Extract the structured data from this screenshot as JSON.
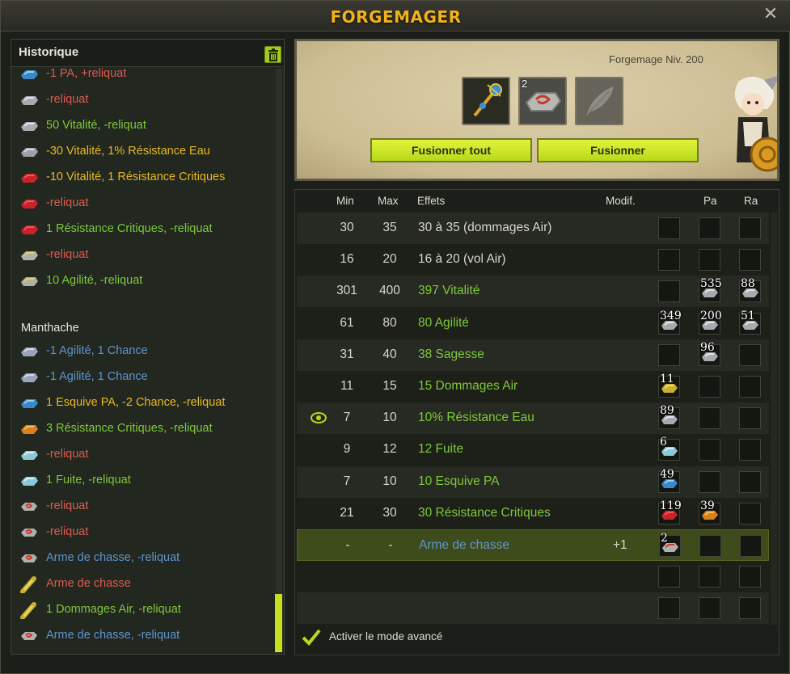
{
  "window": {
    "title": "FORGEMAGER",
    "close_label": "✕"
  },
  "history": {
    "title": "Historique",
    "entries_top": [
      {
        "text": "-1 PA, +reliquat",
        "color": "red",
        "icon": "blue-rune-icon"
      },
      {
        "text": "-reliquat",
        "color": "red",
        "icon": "gray-rune-icon"
      },
      {
        "text": "50 Vitalité, -reliquat",
        "color": "green",
        "icon": "gray-rune-icon"
      },
      {
        "text": "-30 Vitalité, 1% Résistance Eau",
        "color": "yellow",
        "icon": "gray-water-rune-icon"
      },
      {
        "text": "-10 Vitalité, 1 Résistance Critiques",
        "color": "yellow",
        "icon": "red-rune-icon"
      },
      {
        "text": "-reliquat",
        "color": "red",
        "icon": "red-rune-icon"
      },
      {
        "text": "1 Résistance Critiques, -reliquat",
        "color": "green",
        "icon": "red-rune-icon"
      },
      {
        "text": "-reliquat",
        "color": "red",
        "icon": "yellow-gray-rune-icon"
      },
      {
        "text": "10 Agilité, -reliquat",
        "color": "green",
        "icon": "yellow-gray-rune-icon"
      }
    ],
    "group_label": "Manthache",
    "entries_bottom": [
      {
        "text": "-1 Agilité, 1 Chance",
        "color": "blue",
        "icon": "blue-gray-rune-icon"
      },
      {
        "text": "-1 Agilité, 1 Chance",
        "color": "blue",
        "icon": "blue-gray-rune-icon"
      },
      {
        "text": "1 Esquive PA, -2 Chance, -reliquat",
        "color": "yellow",
        "icon": "blue-rune-icon"
      },
      {
        "text": "3 Résistance Critiques, -reliquat",
        "color": "green",
        "icon": "orange-rune-icon"
      },
      {
        "text": "-reliquat",
        "color": "red",
        "icon": "cyan-rune-icon"
      },
      {
        "text": "1 Fuite, -reliquat",
        "color": "green",
        "icon": "cyan-rune-icon"
      },
      {
        "text": "-reliquat",
        "color": "red",
        "icon": "hunting-rune-icon"
      },
      {
        "text": "-reliquat",
        "color": "red",
        "icon": "hunting-rune-icon"
      },
      {
        "text": "Arme de chasse, -reliquat",
        "color": "blue",
        "icon": "hunting-rune-icon"
      },
      {
        "text": "Arme de chasse",
        "color": "red",
        "icon": "potion-icon"
      },
      {
        "text": "1 Dommages Air, -reliquat",
        "color": "green",
        "icon": "potion-icon"
      },
      {
        "text": "Arme de chasse, -reliquat",
        "color": "blue",
        "icon": "hunting-rune-icon"
      }
    ]
  },
  "forge": {
    "level_label": "Forgemage Niv. 200",
    "slot2_count": "2",
    "fuse_all_label": "Fusionner tout",
    "fuse_label": "Fusionner"
  },
  "table": {
    "headers": {
      "min": "Min",
      "max": "Max",
      "effects": "Effets",
      "modif": "Modif.",
      "pa": "Pa",
      "ra": "Ra"
    },
    "rows": [
      {
        "min": "30",
        "max": "35",
        "effect": "30 à 35 (dommages Air)",
        "color": "#d6d6ce",
        "modif": "",
        "eye": false,
        "ba": "",
        "pa": "",
        "ra": "",
        "ba_icon": "",
        "pa_icon": "",
        "ra_icon": ""
      },
      {
        "min": "16",
        "max": "20",
        "effect": "16 à 20 (vol Air)",
        "color": "#d6d6ce",
        "modif": "",
        "eye": false,
        "ba": "",
        "pa": "",
        "ra": "",
        "ba_icon": "",
        "pa_icon": "",
        "ra_icon": ""
      },
      {
        "min": "301",
        "max": "400",
        "effect": "397 Vitalité",
        "color": "#7ec83a",
        "modif": "",
        "eye": false,
        "ba": "",
        "pa": "535",
        "ra": "88",
        "ba_icon": "",
        "pa_icon": "gray",
        "ra_icon": "gray"
      },
      {
        "min": "61",
        "max": "80",
        "effect": "80 Agilité",
        "color": "#7ec83a",
        "modif": "",
        "eye": false,
        "ba": "349",
        "pa": "200",
        "ra": "51",
        "ba_icon": "gray",
        "pa_icon": "gray",
        "ra_icon": "gray"
      },
      {
        "min": "31",
        "max": "40",
        "effect": "38 Sagesse",
        "color": "#7ec83a",
        "modif": "",
        "eye": false,
        "ba": "",
        "pa": "96",
        "ra": "",
        "ba_icon": "",
        "pa_icon": "gray",
        "ra_icon": ""
      },
      {
        "min": "11",
        "max": "15",
        "effect": "15 Dommages Air",
        "color": "#7ec83a",
        "modif": "",
        "eye": false,
        "ba": "11",
        "pa": "",
        "ra": "",
        "ba_icon": "potion",
        "pa_icon": "",
        "ra_icon": ""
      },
      {
        "min": "7",
        "max": "10",
        "effect": "10% Résistance Eau",
        "color": "#7ec83a",
        "modif": "",
        "eye": true,
        "ba": "89",
        "pa": "",
        "ra": "",
        "ba_icon": "gray",
        "pa_icon": "",
        "ra_icon": ""
      },
      {
        "min": "9",
        "max": "12",
        "effect": "12 Fuite",
        "color": "#7ec83a",
        "modif": "",
        "eye": false,
        "ba": "6",
        "pa": "",
        "ra": "",
        "ba_icon": "cyan",
        "pa_icon": "",
        "ra_icon": ""
      },
      {
        "min": "7",
        "max": "10",
        "effect": "10 Esquive PA",
        "color": "#7ec83a",
        "modif": "",
        "eye": false,
        "ba": "49",
        "pa": "",
        "ra": "",
        "ba_icon": "blue",
        "pa_icon": "",
        "ra_icon": ""
      },
      {
        "min": "21",
        "max": "30",
        "effect": "30 Résistance Critiques",
        "color": "#7ec83a",
        "modif": "",
        "eye": false,
        "ba": "119",
        "pa": "39",
        "ra": "",
        "ba_icon": "red",
        "pa_icon": "orange",
        "ra_icon": ""
      },
      {
        "min": "-",
        "max": "-",
        "effect": "Arme de chasse",
        "color": "#5f95cf",
        "modif": "+1",
        "eye": false,
        "ba": "2",
        "pa": "",
        "ra": "",
        "ba_icon": "hunting",
        "pa_icon": "",
        "ra_icon": "",
        "highlight": true
      },
      {
        "min": "",
        "max": "",
        "effect": "",
        "color": "#d6d6ce",
        "modif": "",
        "eye": false,
        "ba": "",
        "pa": "",
        "ra": "",
        "ba_icon": "",
        "pa_icon": "",
        "ra_icon": ""
      },
      {
        "min": "",
        "max": "",
        "effect": "",
        "color": "#d6d6ce",
        "modif": "",
        "eye": false,
        "ba": "",
        "pa": "",
        "ra": "",
        "ba_icon": "",
        "pa_icon": "",
        "ra_icon": ""
      }
    ],
    "advanced_label": "Activer le mode avancé"
  }
}
